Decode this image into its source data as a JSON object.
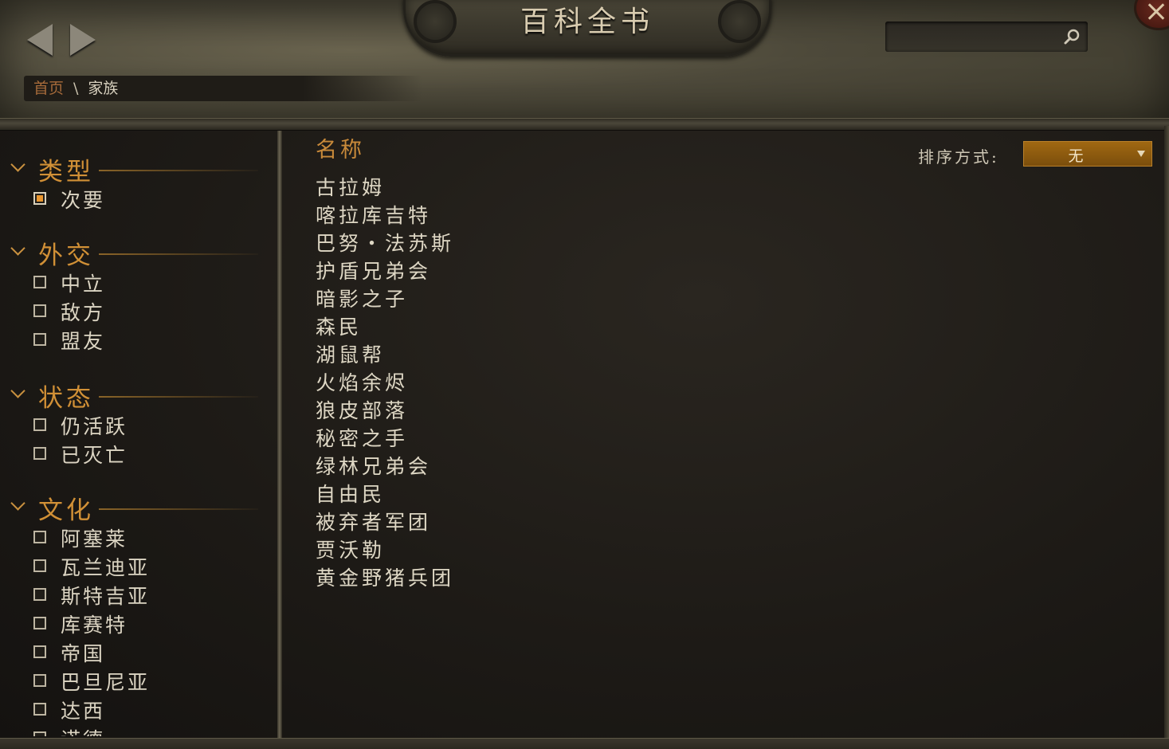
{
  "header": {
    "title": "百科全书",
    "search": {
      "value": "",
      "placeholder": ""
    },
    "icons": {
      "back": "back-arrow-icon",
      "forward": "forward-arrow-icon",
      "search": "search-icon",
      "close": "close-icon"
    }
  },
  "breadcrumb": {
    "home": "首页",
    "separator": "\\",
    "current": "家族"
  },
  "filters": [
    {
      "title": "类型",
      "items": [
        {
          "label": "次要",
          "checked": true
        }
      ]
    },
    {
      "title": "外交",
      "items": [
        {
          "label": "中立",
          "checked": false
        },
        {
          "label": "敌方",
          "checked": false
        },
        {
          "label": "盟友",
          "checked": false
        }
      ]
    },
    {
      "title": "状态",
      "items": [
        {
          "label": "仍活跃",
          "checked": false
        },
        {
          "label": "已灭亡",
          "checked": false
        }
      ]
    },
    {
      "title": "文化",
      "items": [
        {
          "label": "阿塞莱",
          "checked": false
        },
        {
          "label": "瓦兰迪亚",
          "checked": false
        },
        {
          "label": "斯特吉亚",
          "checked": false
        },
        {
          "label": "库赛特",
          "checked": false
        },
        {
          "label": "帝国",
          "checked": false
        },
        {
          "label": "巴旦尼亚",
          "checked": false
        },
        {
          "label": "达西",
          "checked": false
        },
        {
          "label": "诺德",
          "checked": false
        }
      ]
    }
  ],
  "main": {
    "column_header": "名称",
    "sort": {
      "label": "排序方式:",
      "value": "无"
    },
    "names": [
      "古拉姆",
      "喀拉库吉特",
      "巴努・法苏斯",
      "护盾兄弟会",
      "暗影之子",
      "森民",
      "湖鼠帮",
      "火焰余烬",
      "狼皮部落",
      "秘密之手",
      "绿林兄弟会",
      "自由民",
      "被弃者军团",
      "贾沃勒",
      "黄金野猪兵团"
    ]
  },
  "colors": {
    "accent_orange": "#d19036",
    "breadcrumb_home": "#a56a3a",
    "sort_dropdown": "#a06812",
    "text": "#ded7c4"
  }
}
